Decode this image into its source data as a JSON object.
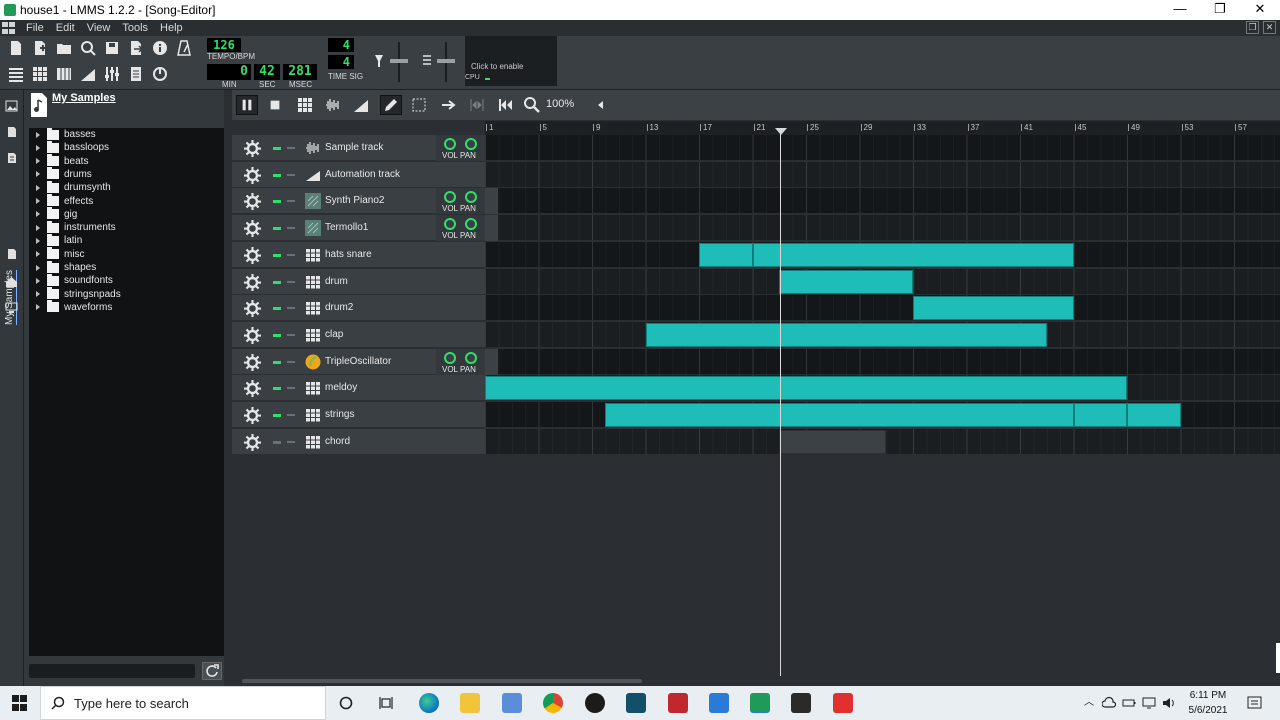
{
  "window": {
    "title": "house1 - LMMS 1.2.2 - [Song-Editor]",
    "controls": [
      "—",
      "❐",
      "✕"
    ]
  },
  "menu": {
    "items": [
      "File",
      "Edit",
      "View",
      "Tools",
      "Help"
    ]
  },
  "toolbar": {
    "tempo_value": "126",
    "tempo_label": "TEMPO/BPM",
    "time_min": "0",
    "time_sec": "42",
    "time_msec": "281",
    "min_label": "MIN",
    "sec_label": "SEC",
    "msec_label": "MSEC",
    "timesig_num": "4",
    "timesig_den": "4",
    "timesig_label": "TIME SIG",
    "cpu_hint": "Click to enable",
    "cpu_label": "CPU"
  },
  "browser": {
    "title": "My Samples",
    "side_tab": "My Samples",
    "folders": [
      "basses",
      "bassloops",
      "beats",
      "drums",
      "drumsynth",
      "effects",
      "gig",
      "instruments",
      "latin",
      "misc",
      "shapes",
      "soundfonts",
      "stringsnpads",
      "waveforms"
    ]
  },
  "song_editor": {
    "zoom": "100%",
    "bar_numbers": [
      "1",
      "5",
      "9",
      "13",
      "17",
      "21",
      "25",
      "29",
      "33",
      "37",
      "41",
      "45",
      "49",
      "53",
      "57"
    ],
    "playhead_bar": 23,
    "tracks": [
      {
        "name": "Sample track",
        "icon": "waveform-icon",
        "knobs": true,
        "vol_label": "VOL",
        "pan_label": "PAN",
        "clips": []
      },
      {
        "name": "Automation track",
        "icon": "automation-icon",
        "knobs": false,
        "clips": []
      },
      {
        "name": "Synth Piano2",
        "icon": "instrument-icon",
        "knobs": true,
        "vol_label": "VOL",
        "pan_label": "PAN",
        "clips": []
      },
      {
        "name": "Termollo1",
        "icon": "instrument-icon",
        "knobs": true,
        "vol_label": "VOL",
        "pan_label": "PAN",
        "clips": []
      },
      {
        "name": "hats snare",
        "icon": "beat-pattern-icon",
        "knobs": false,
        "clips": [
          [
            17,
            21
          ],
          [
            21,
            45
          ]
        ]
      },
      {
        "name": "drum",
        "icon": "beat-pattern-icon",
        "knobs": false,
        "clips": [
          [
            23,
            33
          ]
        ]
      },
      {
        "name": "drum2",
        "icon": "beat-pattern-icon",
        "knobs": false,
        "clips": [
          [
            33,
            45
          ]
        ]
      },
      {
        "name": "clap",
        "icon": "beat-pattern-icon",
        "knobs": false,
        "clips": [
          [
            13,
            43
          ]
        ]
      },
      {
        "name": "TripleOscillator",
        "icon": "triple-oscillator-icon",
        "knobs": true,
        "vol_label": "VOL",
        "pan_label": "PAN",
        "clips": []
      },
      {
        "name": "meldoy",
        "icon": "beat-pattern-icon",
        "knobs": false,
        "clips": [
          [
            1,
            49
          ]
        ]
      },
      {
        "name": "strings",
        "icon": "beat-pattern-icon",
        "knobs": false,
        "clips": [
          [
            10,
            45
          ],
          [
            45,
            49
          ],
          [
            49,
            53
          ]
        ]
      },
      {
        "name": "chord",
        "icon": "beat-pattern-icon",
        "knobs": false,
        "muted": true,
        "clips": [
          [
            23,
            31,
            "gray"
          ]
        ]
      }
    ]
  },
  "taskbar": {
    "search_placeholder": "Type here to search",
    "time": "6:11 PM",
    "date": "5/6/2021"
  },
  "colors": {
    "clip": "#1fbdb8",
    "lcd_green": "#2ee06a",
    "accent": "#2ee06a"
  }
}
